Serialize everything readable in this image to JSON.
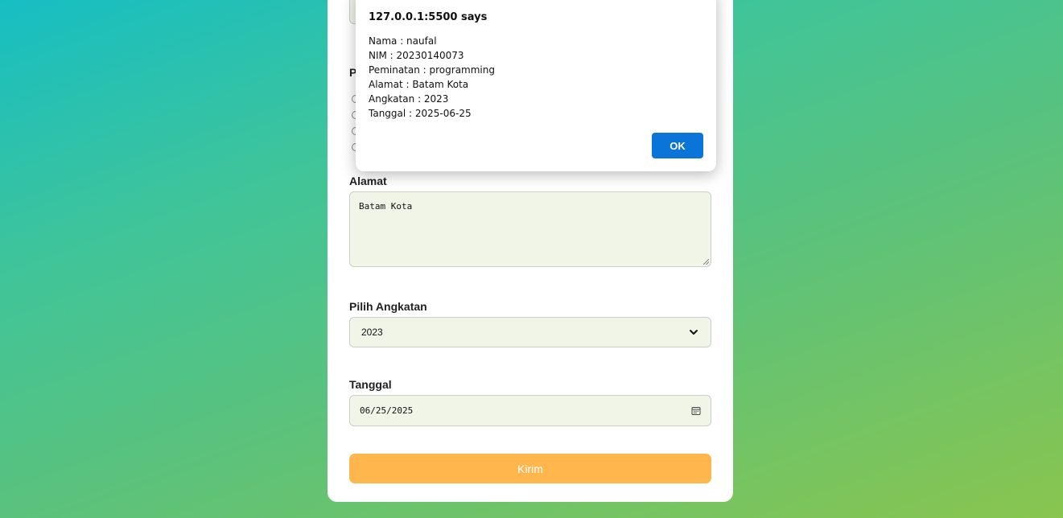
{
  "dialog": {
    "title": "127.0.0.1:5500 says",
    "lines": [
      "Nama : naufal",
      "NIM : 20230140073",
      "Peminatan : programming",
      "Alamat : Batam Kota",
      "Angkatan : 2023",
      "Tanggal : 2025-06-25"
    ],
    "ok_label": "OK",
    "ok_color": "#0b74d8"
  },
  "form": {
    "peminatan_label_partial": "P",
    "alamat_label": "Alamat",
    "alamat_value": "Batam Kota",
    "angkatan_label": "Pilih Angkatan",
    "angkatan_value": "2023",
    "tanggal_label": "Tanggal",
    "tanggal_value": "06/25/2025",
    "submit_label": "Kirim",
    "submit_color": "#ffb64d",
    "field_bg_color": "#f1f5e8"
  },
  "icons": {
    "select_chevron": "chevron-down-icon",
    "date_picker": "calendar-icon"
  }
}
